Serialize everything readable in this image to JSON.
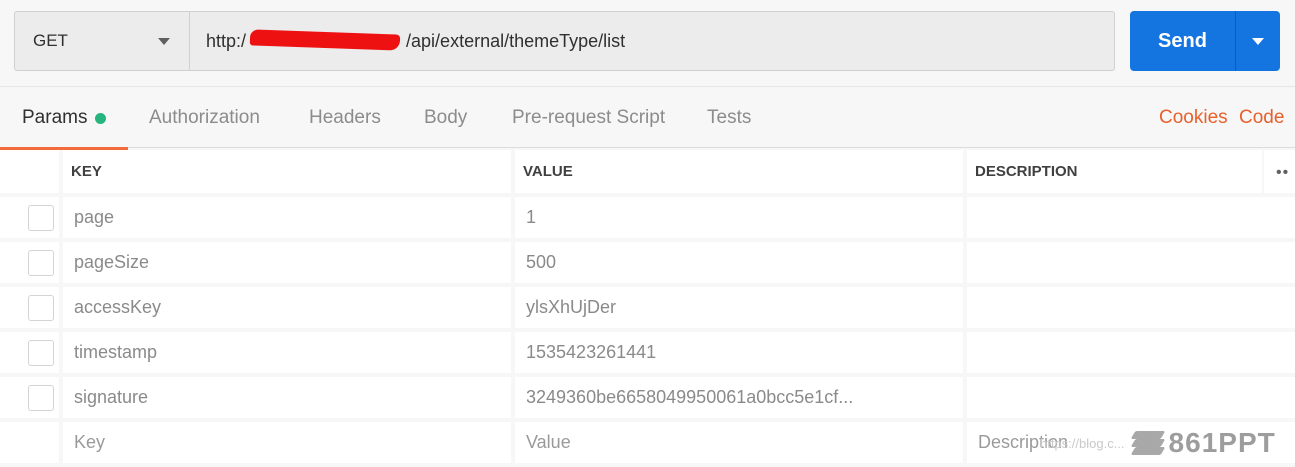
{
  "request": {
    "method": "GET",
    "url_prefix": "http:/",
    "url_suffix": "/api/external/themeType/list",
    "send_label": "Send"
  },
  "tabs": [
    {
      "label": "Params"
    },
    {
      "label": "Authorization"
    },
    {
      "label": "Headers"
    },
    {
      "label": "Body"
    },
    {
      "label": "Pre-request Script"
    },
    {
      "label": "Tests"
    }
  ],
  "tab_links": {
    "cookies": "Cookies",
    "code": "Code"
  },
  "params": {
    "headers": {
      "key": "KEY",
      "value": "VALUE",
      "description": "DESCRIPTION"
    },
    "rows": [
      {
        "key": "page",
        "value": "1",
        "description": ""
      },
      {
        "key": "pageSize",
        "value": "500",
        "description": ""
      },
      {
        "key": "accessKey",
        "value": "ylsXhUjDer",
        "description": ""
      },
      {
        "key": "timestamp",
        "value": "1535423261441",
        "description": ""
      },
      {
        "key": "signature",
        "value": "3249360be6658049950061a0bcc5e1cf...",
        "description": ""
      }
    ],
    "placeholders": {
      "key": "Key",
      "value": "Value",
      "description": "Description"
    }
  },
  "watermark": {
    "url": "https://blog.c...",
    "logo": "861PPT"
  },
  "colors": {
    "accent": "#f26b3a",
    "send": "#1475e0",
    "dot": "#26b47f"
  }
}
